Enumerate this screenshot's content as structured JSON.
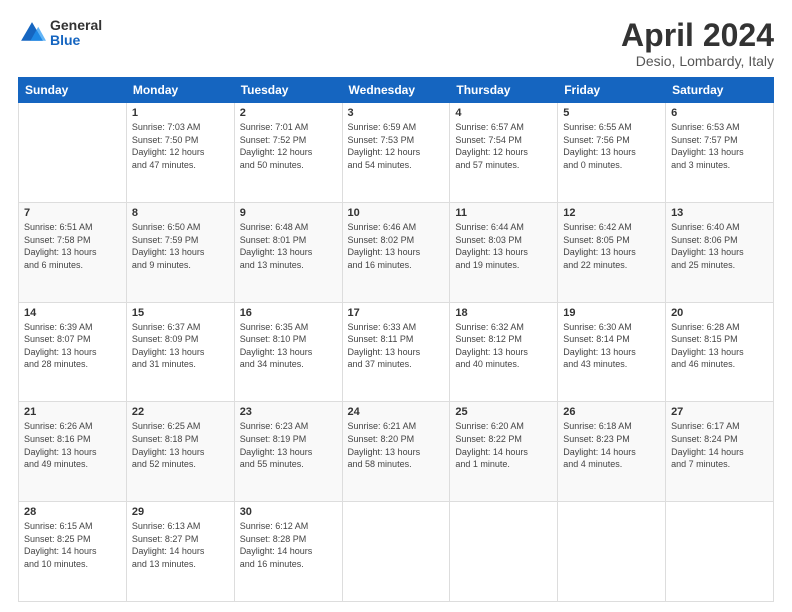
{
  "header": {
    "logo_general": "General",
    "logo_blue": "Blue",
    "title": "April 2024",
    "subtitle": "Desio, Lombardy, Italy"
  },
  "columns": [
    "Sunday",
    "Monday",
    "Tuesday",
    "Wednesday",
    "Thursday",
    "Friday",
    "Saturday"
  ],
  "weeks": [
    [
      {
        "day": "",
        "info": ""
      },
      {
        "day": "1",
        "info": "Sunrise: 7:03 AM\nSunset: 7:50 PM\nDaylight: 12 hours\nand 47 minutes."
      },
      {
        "day": "2",
        "info": "Sunrise: 7:01 AM\nSunset: 7:52 PM\nDaylight: 12 hours\nand 50 minutes."
      },
      {
        "day": "3",
        "info": "Sunrise: 6:59 AM\nSunset: 7:53 PM\nDaylight: 12 hours\nand 54 minutes."
      },
      {
        "day": "4",
        "info": "Sunrise: 6:57 AM\nSunset: 7:54 PM\nDaylight: 12 hours\nand 57 minutes."
      },
      {
        "day": "5",
        "info": "Sunrise: 6:55 AM\nSunset: 7:56 PM\nDaylight: 13 hours\nand 0 minutes."
      },
      {
        "day": "6",
        "info": "Sunrise: 6:53 AM\nSunset: 7:57 PM\nDaylight: 13 hours\nand 3 minutes."
      }
    ],
    [
      {
        "day": "7",
        "info": "Sunrise: 6:51 AM\nSunset: 7:58 PM\nDaylight: 13 hours\nand 6 minutes."
      },
      {
        "day": "8",
        "info": "Sunrise: 6:50 AM\nSunset: 7:59 PM\nDaylight: 13 hours\nand 9 minutes."
      },
      {
        "day": "9",
        "info": "Sunrise: 6:48 AM\nSunset: 8:01 PM\nDaylight: 13 hours\nand 13 minutes."
      },
      {
        "day": "10",
        "info": "Sunrise: 6:46 AM\nSunset: 8:02 PM\nDaylight: 13 hours\nand 16 minutes."
      },
      {
        "day": "11",
        "info": "Sunrise: 6:44 AM\nSunset: 8:03 PM\nDaylight: 13 hours\nand 19 minutes."
      },
      {
        "day": "12",
        "info": "Sunrise: 6:42 AM\nSunset: 8:05 PM\nDaylight: 13 hours\nand 22 minutes."
      },
      {
        "day": "13",
        "info": "Sunrise: 6:40 AM\nSunset: 8:06 PM\nDaylight: 13 hours\nand 25 minutes."
      }
    ],
    [
      {
        "day": "14",
        "info": "Sunrise: 6:39 AM\nSunset: 8:07 PM\nDaylight: 13 hours\nand 28 minutes."
      },
      {
        "day": "15",
        "info": "Sunrise: 6:37 AM\nSunset: 8:09 PM\nDaylight: 13 hours\nand 31 minutes."
      },
      {
        "day": "16",
        "info": "Sunrise: 6:35 AM\nSunset: 8:10 PM\nDaylight: 13 hours\nand 34 minutes."
      },
      {
        "day": "17",
        "info": "Sunrise: 6:33 AM\nSunset: 8:11 PM\nDaylight: 13 hours\nand 37 minutes."
      },
      {
        "day": "18",
        "info": "Sunrise: 6:32 AM\nSunset: 8:12 PM\nDaylight: 13 hours\nand 40 minutes."
      },
      {
        "day": "19",
        "info": "Sunrise: 6:30 AM\nSunset: 8:14 PM\nDaylight: 13 hours\nand 43 minutes."
      },
      {
        "day": "20",
        "info": "Sunrise: 6:28 AM\nSunset: 8:15 PM\nDaylight: 13 hours\nand 46 minutes."
      }
    ],
    [
      {
        "day": "21",
        "info": "Sunrise: 6:26 AM\nSunset: 8:16 PM\nDaylight: 13 hours\nand 49 minutes."
      },
      {
        "day": "22",
        "info": "Sunrise: 6:25 AM\nSunset: 8:18 PM\nDaylight: 13 hours\nand 52 minutes."
      },
      {
        "day": "23",
        "info": "Sunrise: 6:23 AM\nSunset: 8:19 PM\nDaylight: 13 hours\nand 55 minutes."
      },
      {
        "day": "24",
        "info": "Sunrise: 6:21 AM\nSunset: 8:20 PM\nDaylight: 13 hours\nand 58 minutes."
      },
      {
        "day": "25",
        "info": "Sunrise: 6:20 AM\nSunset: 8:22 PM\nDaylight: 14 hours\nand 1 minute."
      },
      {
        "day": "26",
        "info": "Sunrise: 6:18 AM\nSunset: 8:23 PM\nDaylight: 14 hours\nand 4 minutes."
      },
      {
        "day": "27",
        "info": "Sunrise: 6:17 AM\nSunset: 8:24 PM\nDaylight: 14 hours\nand 7 minutes."
      }
    ],
    [
      {
        "day": "28",
        "info": "Sunrise: 6:15 AM\nSunset: 8:25 PM\nDaylight: 14 hours\nand 10 minutes."
      },
      {
        "day": "29",
        "info": "Sunrise: 6:13 AM\nSunset: 8:27 PM\nDaylight: 14 hours\nand 13 minutes."
      },
      {
        "day": "30",
        "info": "Sunrise: 6:12 AM\nSunset: 8:28 PM\nDaylight: 14 hours\nand 16 minutes."
      },
      {
        "day": "",
        "info": ""
      },
      {
        "day": "",
        "info": ""
      },
      {
        "day": "",
        "info": ""
      },
      {
        "day": "",
        "info": ""
      }
    ]
  ]
}
